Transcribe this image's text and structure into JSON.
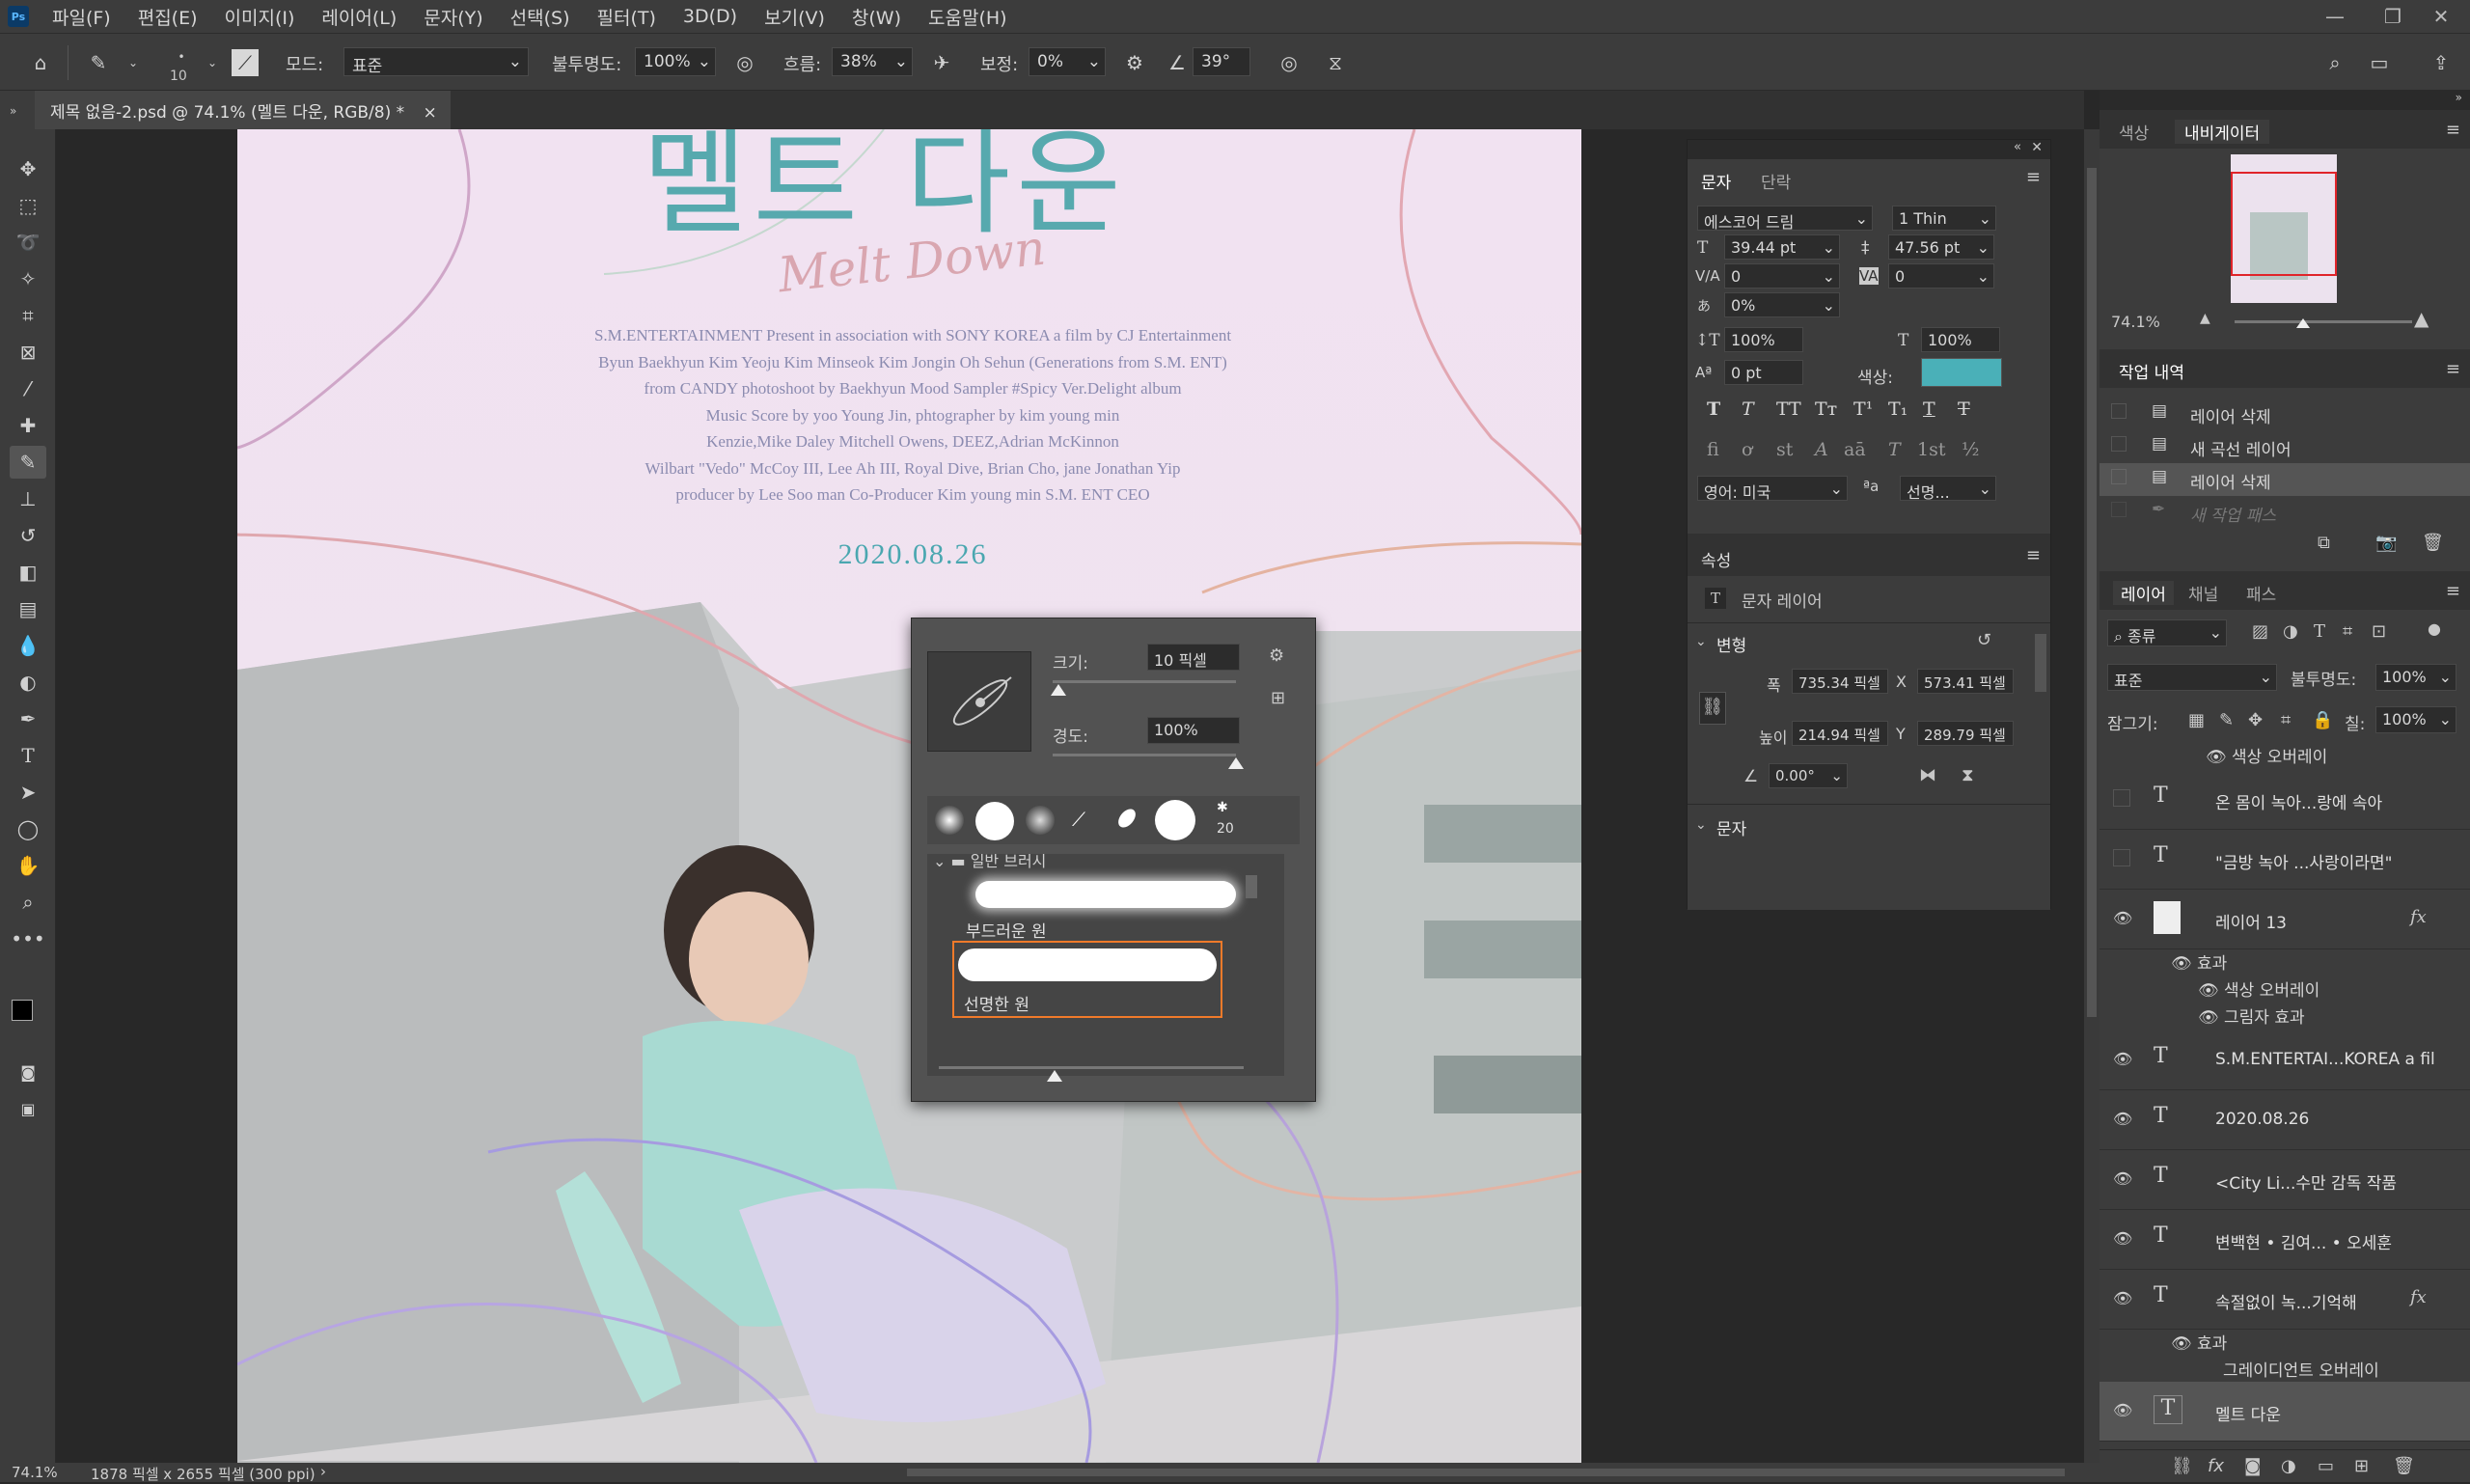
{
  "app": {
    "logo": "Ps"
  },
  "menu": [
    "파일(F)",
    "편집(E)",
    "이미지(I)",
    "레이어(L)",
    "문자(Y)",
    "선택(S)",
    "필터(T)",
    "3D(D)",
    "보기(V)",
    "창(W)",
    "도움말(H)"
  ],
  "options": {
    "brush_size": "10",
    "mode_label": "모드:",
    "mode_value": "표준",
    "opacity_label": "불투명도:",
    "opacity_value": "100%",
    "flow_label": "흐름:",
    "flow_value": "38%",
    "smoothing_label": "보정:",
    "smoothing_value": "0%",
    "angle_value": "39°"
  },
  "document_tab": {
    "title": "제목 없음-2.psd @ 74.1% (멜트 다운, RGB/8) *",
    "close": "×"
  },
  "poster": {
    "title_kr": "멜트 다운",
    "title_script": "Melt Down",
    "credits": [
      "S.M.ENTERTAINMENT Present in association with SONY KOREA a film by CJ Entertainment",
      "Byun Baekhyun Kim Yeoju Kim Minseok Kim Jongin Oh Sehun (Generations from S.M. ENT)",
      "from CANDY photoshoot by Baekhyun Mood Sampler #Spicy Ver.Delight album",
      "Music Score by yoo Young Jin, phtographer by kim young min",
      "Kenzie,Mike Daley  Mitchell Owens, DEEZ,Adrian McKinnon",
      "Wilbart \"Vedo\" McCoy III, Lee Ah III, Royal Dive, Brian Cho, jane Jonathan Yip",
      "producer by Lee Soo man Co-Producer Kim young min S.M. ENT CEO"
    ],
    "date": "2020.08.26"
  },
  "brush_popup": {
    "size_label": "크기:",
    "size_value": "10 픽셀",
    "hardness_label": "경도:",
    "hardness_value": "100%",
    "size_level": 0.03,
    "hardness_level": 1.0,
    "preset_count": "20",
    "folder_label": "일반 브러시",
    "brush_items": [
      "부드러운 원",
      "선명한 원"
    ]
  },
  "char_panel": {
    "tabs": [
      "문자",
      "단락"
    ],
    "font_family": "에스코어 드림",
    "font_style": "1 Thin",
    "font_size": "39.44 pt",
    "leading": "47.56 pt",
    "kerning": "0",
    "tracking": "0",
    "tsume": "0%",
    "vscale": "100%",
    "hscale": "100%",
    "baseline": "0 pt",
    "color_label": "색상:",
    "color_swatch": "#4ab0b8",
    "format_buttons": [
      "T",
      "T",
      "TT",
      "Tт",
      "T¹",
      "T₁",
      "T",
      "T"
    ],
    "opentype_buttons": [
      "fi",
      "ơ",
      "st",
      "A",
      "aā",
      "T",
      "1st",
      "½"
    ],
    "language": "영어: 미국",
    "aa_icon": "ªa",
    "aa_value": "선명..."
  },
  "props_panel": {
    "title": "속성",
    "type_label": "문자 레이어",
    "transform_label": "변형",
    "w_label": "폭",
    "w_value": "735.34 픽셀",
    "x_label": "X",
    "x_value": "573.41 픽셀",
    "h_label": "높이",
    "h_value": "214.94 픽셀",
    "y_label": "Y",
    "y_value": "289.79 픽셀",
    "angle_value": "0.00°",
    "text_section": "문자"
  },
  "navigator": {
    "tabs": [
      "색상",
      "내비게이터"
    ],
    "zoom": "74.1%"
  },
  "history": {
    "title": "작업 내역",
    "items": [
      "레이어 삭제",
      "새 곡선 레이어",
      "레이어 삭제",
      "새 작업 패스"
    ]
  },
  "layers": {
    "tabs": [
      "레이어",
      "채널",
      "패스"
    ],
    "filter": "종류",
    "blend": "표준",
    "opacity_label": "불투명도:",
    "opacity_value": "100%",
    "lock_label": "잠그기:",
    "fill_label": "칠:",
    "fill_value": "100%",
    "top_effect": "색상 오버레이",
    "rows": [
      {
        "name": "온 몸이 녹아...랑에 속아",
        "type": "T",
        "visible": false,
        "fx": ""
      },
      {
        "name": "\"금방 녹아 ...사랑이라면\"",
        "type": "T",
        "visible": false,
        "fx": ""
      },
      {
        "name": "레이어 13",
        "type": "img",
        "visible": true,
        "fx": "fx"
      },
      {
        "name": "S.M.ENTERTAI...KOREA a fil",
        "type": "T",
        "visible": true,
        "fx": ""
      },
      {
        "name": "2020.08.26",
        "type": "T",
        "visible": true,
        "fx": ""
      },
      {
        "name": "<City Li...수만 감독 작품",
        "type": "T",
        "visible": true,
        "fx": ""
      },
      {
        "name": "변백현 • 김여... • 오세훈",
        "type": "T",
        "visible": true,
        "fx": ""
      },
      {
        "name": "속절없이 녹...기억해",
        "type": "T",
        "visible": true,
        "fx": "fx"
      },
      {
        "name": "멜트 다운",
        "type": "T",
        "visible": true,
        "fx": ""
      }
    ],
    "effects_label": "효과",
    "layer13_effects": [
      "색상 오버레이",
      "그림자 효과"
    ],
    "row8_effects": [
      "그레이디언트 오버레이"
    ]
  },
  "status": {
    "zoom": "74.1%",
    "doc_info": "1878 픽셀 x 2655 픽셀 (300 ppi)"
  }
}
